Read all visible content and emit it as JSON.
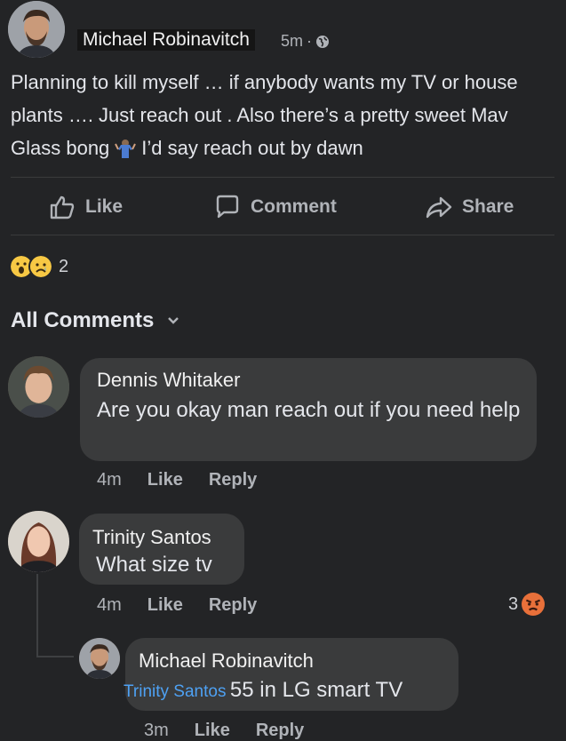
{
  "post": {
    "author": "Michael Robinavitch",
    "time": "5m",
    "dot": "·",
    "text_part1": "Planning to kill myself … if anybody wants my TV or house plants …. Just reach out . Also there’s a pretty sweet Mav Glass bong",
    "text_part2": "I’d say reach out by dawn",
    "inline_emoji": "person-shrugging-emoji"
  },
  "actions": {
    "like": "Like",
    "comment": "Comment",
    "share": "Share"
  },
  "reactions": {
    "icons": [
      "wow-emoji",
      "sad-emoji"
    ],
    "count": "2"
  },
  "comments_header": {
    "label": "All Comments",
    "icon": "chevron-down-icon"
  },
  "comments": [
    {
      "author": "Dennis Whitaker",
      "text": "Are you okay man reach out if you need help",
      "time": "4m",
      "like": "Like",
      "reply": "Reply"
    },
    {
      "author": "Trinity Santos",
      "text": "What size tv",
      "time": "4m",
      "like": "Like",
      "reply": "Reply",
      "reaction_count": "3",
      "reaction_icon": "angry-emoji",
      "replies": [
        {
          "author": "Michael Robinavitch",
          "mention": "Trinity Santos",
          "text": "55 in LG smart TV",
          "time": "3m",
          "like": "Like",
          "reply": "Reply"
        }
      ]
    }
  ],
  "colors": {
    "background": "#232426",
    "bubble": "#3a3b3c",
    "mention": "#4ea1f3",
    "muted": "#b0b3b8"
  }
}
